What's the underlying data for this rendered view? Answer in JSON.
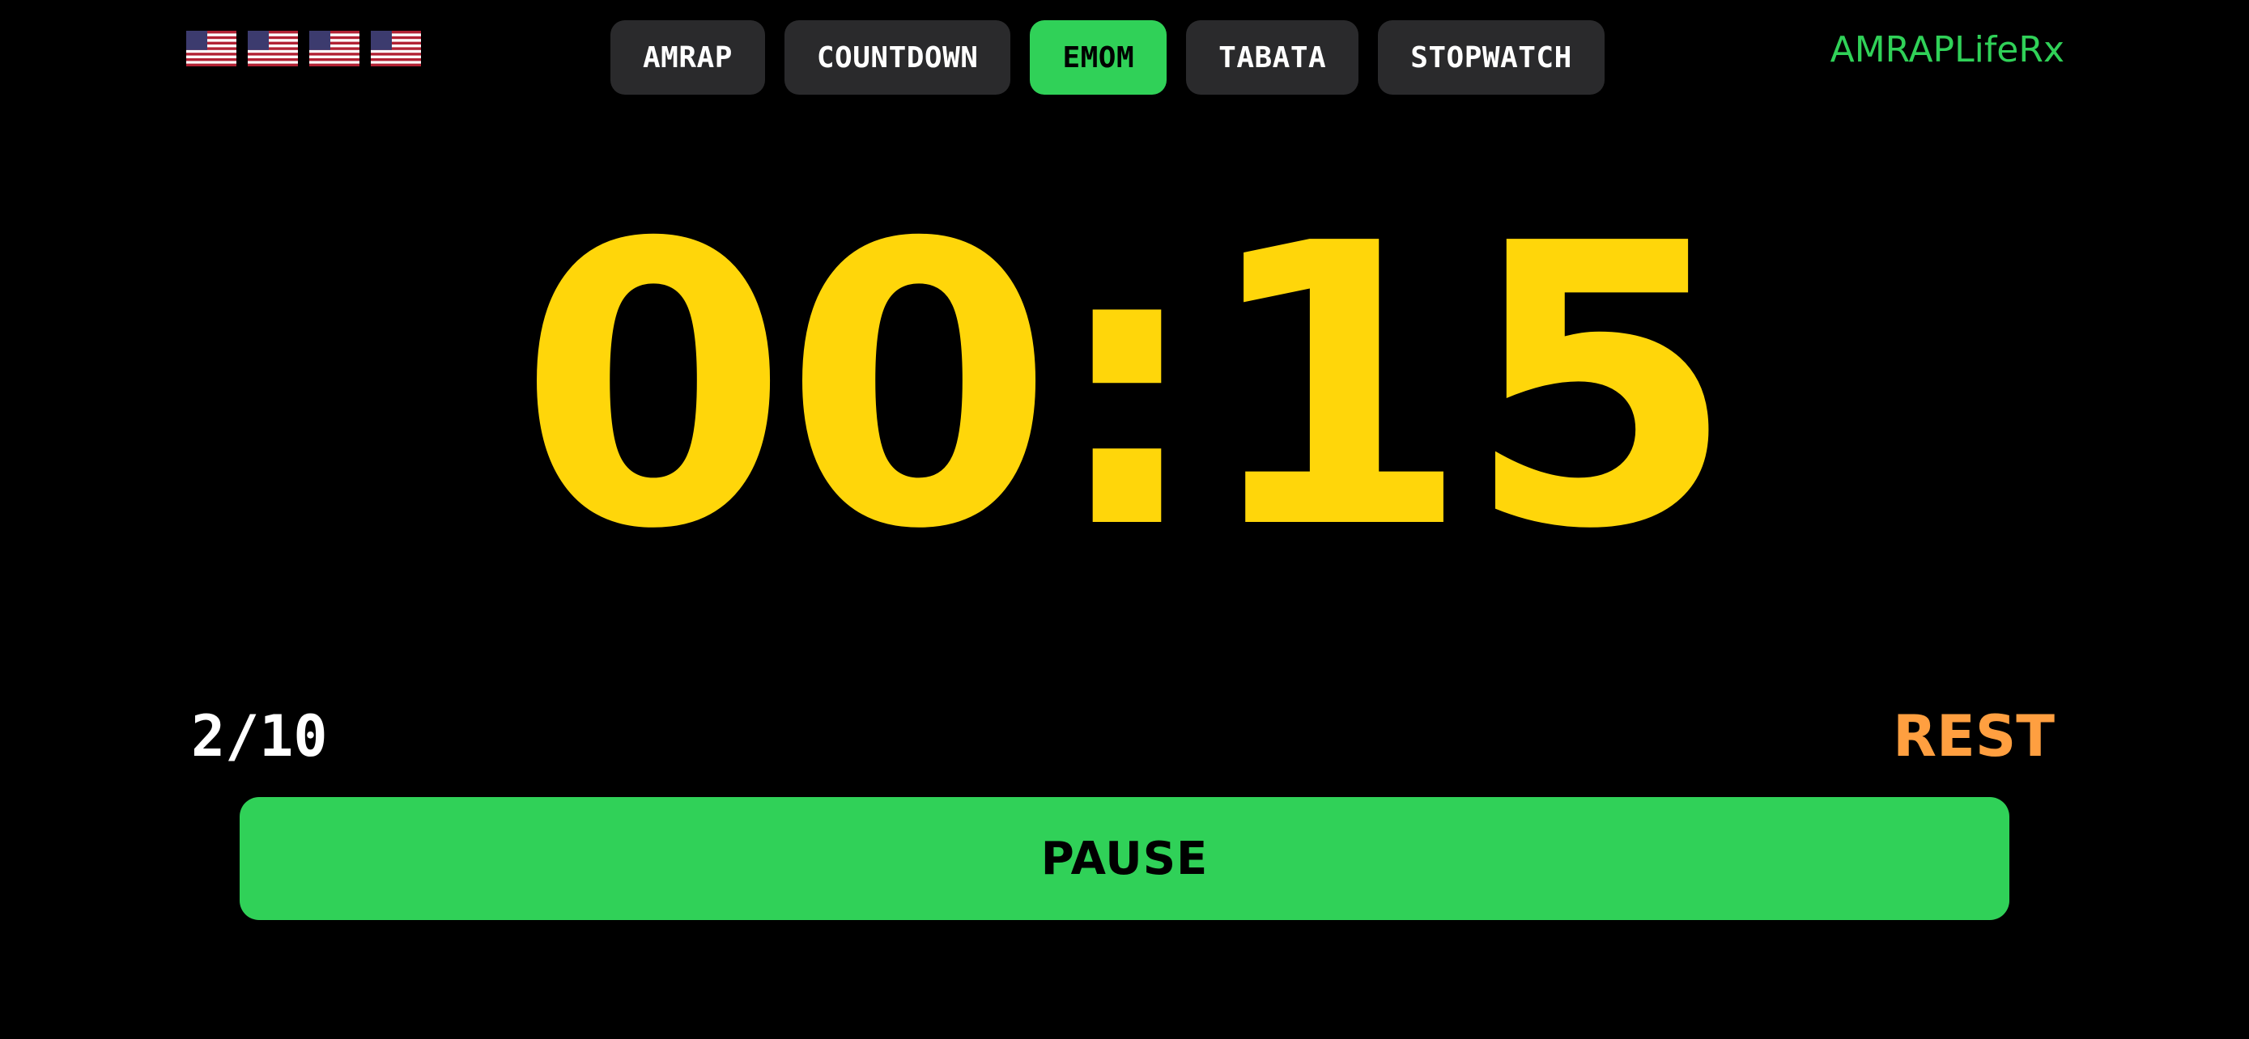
{
  "flags": {
    "items": [
      {
        "icon": "us-flag-icon"
      },
      {
        "icon": "us-flag-icon"
      },
      {
        "icon": "us-flag-icon"
      },
      {
        "icon": "us-flag-icon"
      }
    ]
  },
  "tabs": [
    {
      "label": "AMRAP",
      "active": false
    },
    {
      "label": "COUNTDOWN",
      "active": false
    },
    {
      "label": "EMOM",
      "active": true
    },
    {
      "label": "TABATA",
      "active": false
    },
    {
      "label": "STOPWATCH",
      "active": false
    }
  ],
  "brand": "AMRAPLifeRx",
  "timer": {
    "display": "00:15"
  },
  "round": {
    "text": "2/10"
  },
  "phase": {
    "text": "REST"
  },
  "controls": {
    "pause_label": "PAUSE"
  },
  "colors": {
    "background": "#000000",
    "accent_green": "#30d158",
    "timer_yellow": "#ffd60a",
    "rest_orange": "#ff9f40",
    "tab_inactive": "#2a2a2c"
  }
}
